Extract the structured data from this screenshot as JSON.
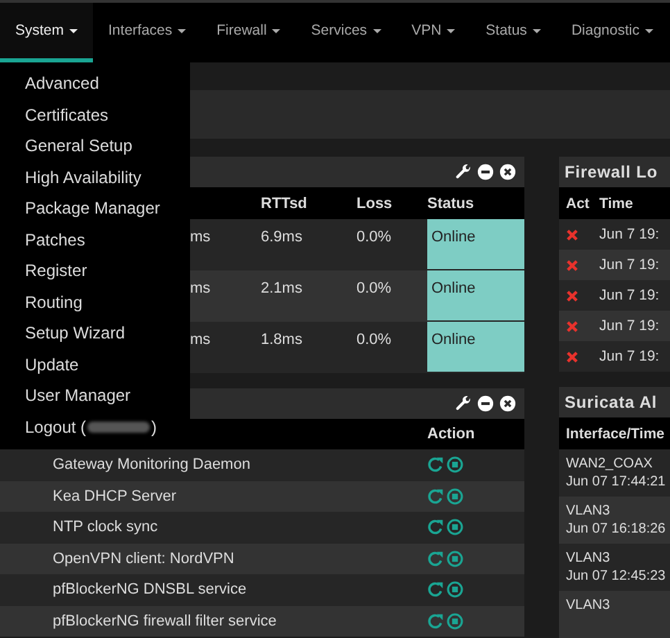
{
  "nav": [
    {
      "label": "System",
      "selected": true
    },
    {
      "label": "Interfaces",
      "selected": false
    },
    {
      "label": "Firewall",
      "selected": false
    },
    {
      "label": "Services",
      "selected": false
    },
    {
      "label": "VPN",
      "selected": false
    },
    {
      "label": "Status",
      "selected": false
    },
    {
      "label": "Diagnostic",
      "selected": false
    }
  ],
  "system_menu": {
    "items": [
      "Advanced",
      "Certificates",
      "General Setup",
      "High Availability",
      "Package Manager",
      "Patches",
      "Register",
      "Routing",
      "Setup Wizard",
      "Update",
      "User Manager"
    ],
    "logout_prefix": "Logout (",
    "logout_suffix": ")"
  },
  "gateways": {
    "columns": [
      "RTTsd",
      "Loss",
      "Status"
    ],
    "rows": [
      {
        "rtt": "ms",
        "rttsd": "6.9ms",
        "loss": "0.0%",
        "status": "Online"
      },
      {
        "rtt": "ms",
        "rttsd": "2.1ms",
        "loss": "0.0%",
        "status": "Online"
      },
      {
        "rtt": "ms",
        "rttsd": "1.8ms",
        "loss": "0.0%",
        "status": "Online"
      }
    ]
  },
  "services": {
    "action_column": "Action",
    "rows": [
      "Gateway Monitoring Daemon",
      "Kea DHCP Server",
      "NTP clock sync",
      "OpenVPN client: NordVPN",
      "pfBlockerNG DNSBL service",
      "pfBlockerNG firewall filter service"
    ]
  },
  "firewall_log": {
    "title": "Firewall Lo",
    "columns": [
      "Act",
      "Time"
    ],
    "rows": [
      "Jun 7 19:",
      "Jun 7 19:",
      "Jun 7 19:",
      "Jun 7 19:",
      "Jun 7 19:"
    ]
  },
  "suricata": {
    "title": "Suricata Al",
    "columns": [
      "Interface/Time"
    ],
    "rows": [
      {
        "interface": "WAN2_COAX",
        "time": "Jun 07 17:44:21"
      },
      {
        "interface": "VLAN3",
        "time": "Jun 07 16:18:26"
      },
      {
        "interface": "VLAN3",
        "time": "Jun 07 12:45:23"
      },
      {
        "interface": "VLAN3"
      }
    ]
  }
}
